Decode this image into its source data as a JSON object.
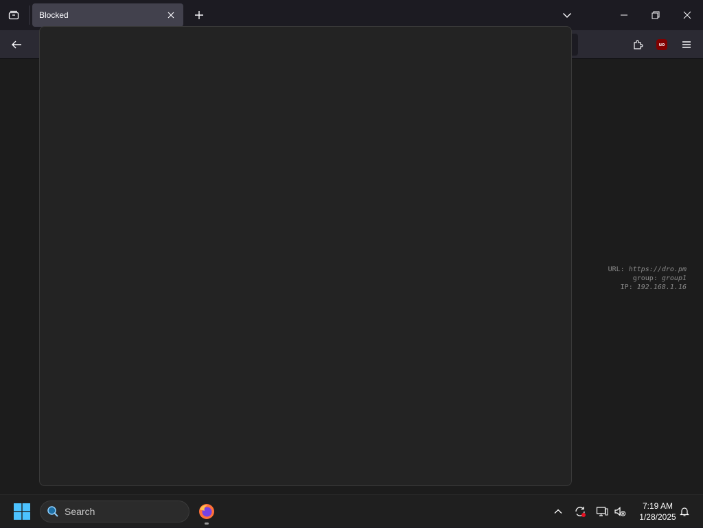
{
  "tab": {
    "title": "Blocked"
  },
  "info": {
    "url_label": "URL:",
    "url_value": "https://dro.pm",
    "group_label": "group:",
    "group_value": "group1",
    "ip_label": "IP:",
    "ip_value": "192.168.1.16"
  },
  "taskbar": {
    "search_placeholder": "Search",
    "time": "7:19 AM",
    "date": "1/28/2025"
  },
  "extensions": {
    "ublock_badge": "uo"
  },
  "colors": {
    "accent": "#0a84ff",
    "ublock": "#800000",
    "start": "#4cc2ff"
  }
}
